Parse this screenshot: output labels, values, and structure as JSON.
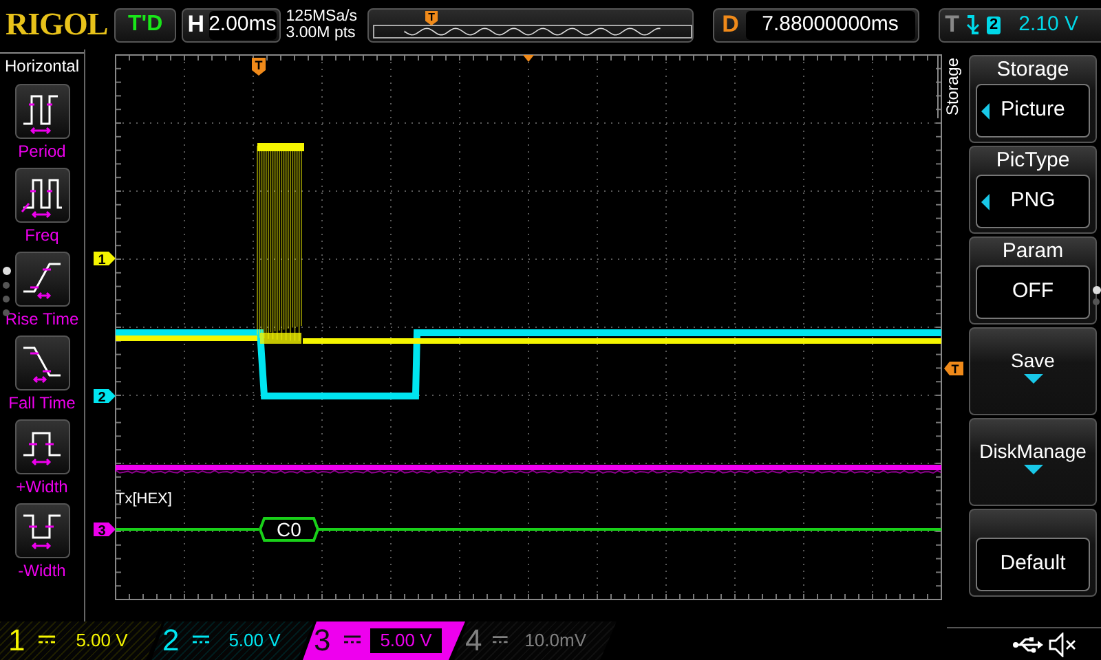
{
  "top_bar": {
    "logo": "RIGOL",
    "run_status": "T'D",
    "timebase": {
      "label": "H",
      "value": "2.00ms"
    },
    "sample_rate": "125MSa/s",
    "memory_depth": "3.00M pts",
    "trigger_position_marker": "T",
    "delay": {
      "label": "D",
      "value": "7.88000000ms"
    },
    "trigger": {
      "label": "T",
      "source": "2",
      "level": "2.10 V"
    }
  },
  "left_menu": {
    "title": "Horizontal",
    "items": [
      {
        "label": "Period",
        "kind": "period"
      },
      {
        "label": "Freq",
        "kind": "freq"
      },
      {
        "label": "Rise Time",
        "kind": "rise"
      },
      {
        "label": "Fall Time",
        "kind": "fall"
      },
      {
        "label": "+Width",
        "kind": "pos_width"
      },
      {
        "label": "-Width",
        "kind": "neg_width"
      }
    ],
    "pages": [
      {
        "selected": true
      },
      {
        "selected": false
      },
      {
        "selected": false
      },
      {
        "selected": false
      }
    ]
  },
  "display": {
    "channel_markers": [
      {
        "label": "1",
        "color": "#f5f500"
      },
      {
        "label": "2",
        "color": "#00e5f0"
      },
      {
        "label": "3",
        "color": "#ee00ee"
      }
    ],
    "trigger_marker": "T",
    "level_marker": "T",
    "decode_label": "Tx[HEX]",
    "decode_packet": "C0"
  },
  "right_menu": {
    "tab": "Storage",
    "items": [
      {
        "title": "Storage",
        "value": "Picture",
        "kind": "select"
      },
      {
        "title": "PicType",
        "value": "PNG",
        "kind": "select"
      },
      {
        "title": "Param",
        "value": "OFF",
        "kind": "value"
      },
      {
        "title": "Save",
        "kind": "submenu"
      },
      {
        "title": "DiskManage",
        "kind": "submenu"
      },
      {
        "value": "Default",
        "kind": "value"
      }
    ],
    "pages": [
      {
        "selected": true
      },
      {
        "selected": false
      }
    ]
  },
  "channels": [
    {
      "number": "1",
      "scale": "5.00 V",
      "color": "#f5f500",
      "selected": false
    },
    {
      "number": "2",
      "scale": "5.00 V",
      "color": "#00e5f0",
      "selected": false
    },
    {
      "number": "3",
      "scale": "5.00 V",
      "color": "#ee00ee",
      "selected": true
    },
    {
      "number": "4",
      "scale": "10.0mV",
      "color": "#808080",
      "selected": false
    }
  ]
}
